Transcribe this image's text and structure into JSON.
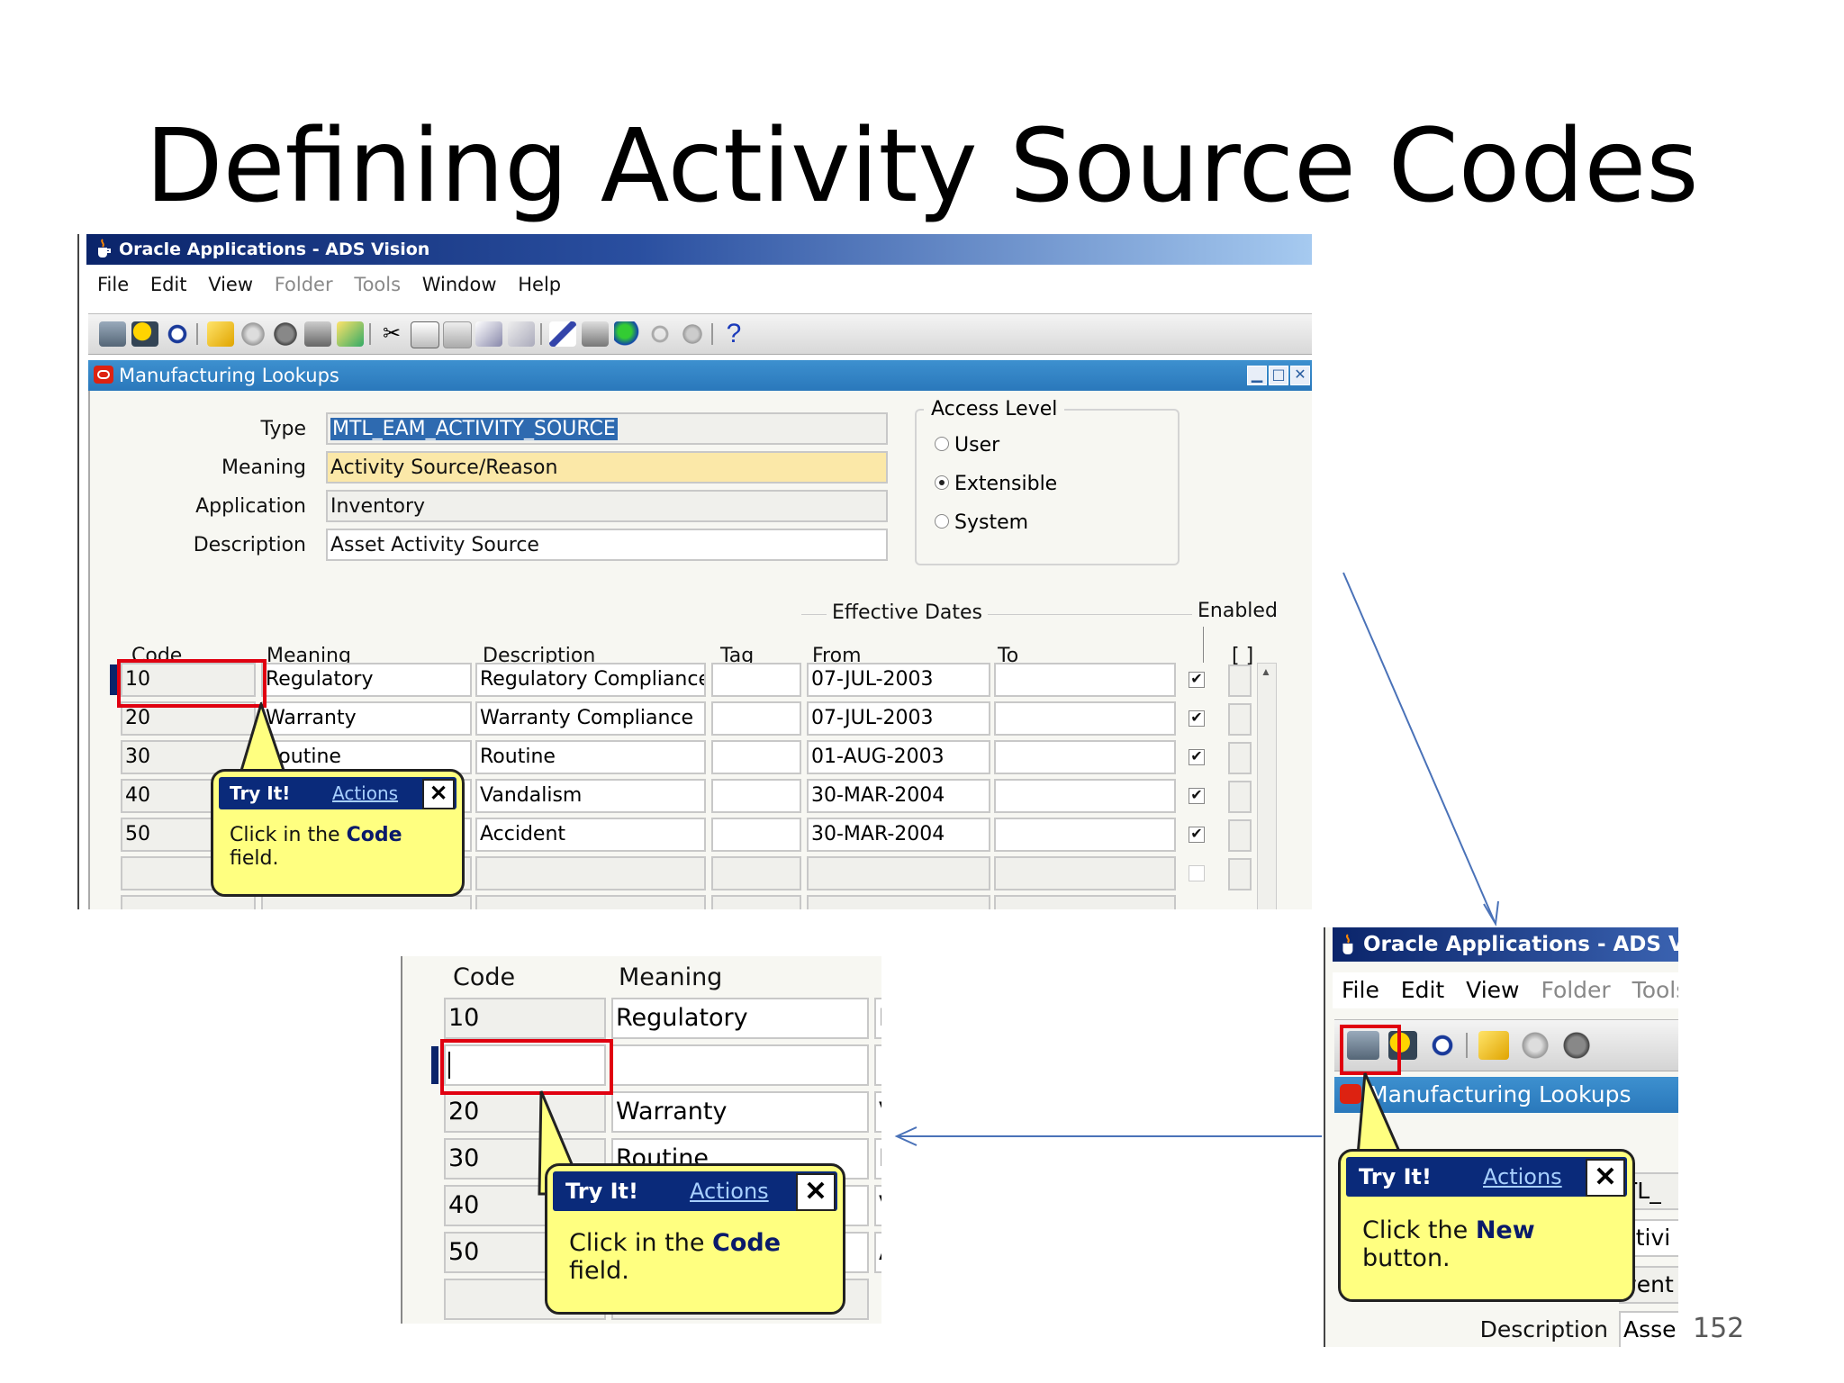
{
  "slide": {
    "title": "Defining Activity Source Codes",
    "page_number": "152"
  },
  "window": {
    "title": "Oracle Applications - ADS Vision",
    "menu": [
      {
        "label": "File",
        "enabled": true
      },
      {
        "label": "Edit",
        "enabled": true
      },
      {
        "label": "View",
        "enabled": true
      },
      {
        "label": "Folder",
        "enabled": false
      },
      {
        "label": "Tools",
        "enabled": false
      },
      {
        "label": "Window",
        "enabled": true
      },
      {
        "label": "Help",
        "enabled": true
      }
    ],
    "toolbar_icons": [
      "new-record-icon",
      "find-icon",
      "navigator-icon",
      "save-icon",
      "next-step-icon",
      "switch-responsibility-icon",
      "print-icon",
      "close-form-icon",
      "cut-icon",
      "copy-icon",
      "paste-icon",
      "clear-record-icon",
      "delete-record-icon",
      "edit-field-icon",
      "zoom-icon",
      "translations-icon",
      "attachments-icon",
      "folder-tools-icon",
      "help-icon"
    ],
    "help_glyph": "?"
  },
  "form": {
    "title": "Manufacturing Lookups",
    "type_label": "Type",
    "type_value": "MTL_EAM_ACTIVITY_SOURCE",
    "meaning_label": "Meaning",
    "meaning_value": "Activity Source/Reason",
    "application_label": "Application",
    "application_value": "Inventory",
    "description_label": "Description",
    "description_value": "Asset Activity Source",
    "access_level": {
      "title": "Access Level",
      "options": [
        "User",
        "Extensible",
        "System"
      ],
      "selected": "Extensible"
    },
    "effective_dates_label": "Effective Dates",
    "enabled_label": "Enabled",
    "dff_label": "[ ]",
    "columns": {
      "code": "Code",
      "meaning": "Meaning",
      "description": "Description",
      "tag": "Tag",
      "from": "From",
      "to": "To"
    },
    "rows": [
      {
        "code": "10",
        "meaning": "Regulatory",
        "description": "Regulatory Compliance",
        "tag": "",
        "from": "07-JUL-2003",
        "to": "",
        "enabled": true
      },
      {
        "code": "20",
        "meaning": "Warranty",
        "description": "Warranty Compliance",
        "tag": "",
        "from": "07-JUL-2003",
        "to": "",
        "enabled": true
      },
      {
        "code": "30",
        "meaning": "Routine",
        "description": "Routine",
        "tag": "",
        "from": "01-AUG-2003",
        "to": "",
        "enabled": true
      },
      {
        "code": "40",
        "meaning": "",
        "description": "Vandalism",
        "tag": "",
        "from": "30-MAR-2004",
        "to": "",
        "enabled": true
      },
      {
        "code": "50",
        "meaning": "",
        "description": "Accident",
        "tag": "",
        "from": "30-MAR-2004",
        "to": "",
        "enabled": true
      }
    ],
    "check_mark": "✔"
  },
  "callouts": {
    "main": {
      "title": "Try It!",
      "actions": "Actions",
      "close": "✕",
      "text_before": "Click in the ",
      "text_bold": "Code",
      "text_after": "field."
    },
    "zoom": {
      "title": "Try It!",
      "actions": "Actions",
      "close": "✕",
      "text_before": "Click in the ",
      "text_bold": "Code",
      "text_after": "field."
    },
    "right": {
      "title": "Try It!",
      "actions": "Actions",
      "close": "✕",
      "text_before": "Click the ",
      "text_bold": "New",
      "text_after": "button."
    }
  },
  "zoom_crop": {
    "code_header": "Code",
    "meaning_header": "Meaning",
    "rows": [
      {
        "code": "10",
        "meaning": "Regulatory",
        "edge": "F"
      },
      {
        "code": "",
        "meaning": "",
        "edge": ""
      },
      {
        "code": "20",
        "meaning": "Warranty",
        "edge": "V"
      },
      {
        "code": "30",
        "meaning": "Routine",
        "edge": "F"
      },
      {
        "code": "40",
        "meaning": "",
        "edge": "V"
      },
      {
        "code": "50",
        "meaning": "",
        "edge": "A"
      }
    ]
  },
  "right_crop": {
    "title": "Oracle Applications - ADS Vis",
    "menu": [
      "File",
      "Edit",
      "View",
      "Folder",
      "Tools"
    ],
    "form_title": "Manufacturing Lookups",
    "partial_fields": [
      "TL_",
      "ctivi",
      "vent",
      "Asse"
    ],
    "description_label": "Description"
  },
  "colors": {
    "title_bar_start": "#0a246a",
    "form_title": "#2a78bb",
    "required_field": "#fbe8a8",
    "highlight_box": "#e00010",
    "callout_bg": "#ffff80",
    "arrow": "#4a72b8"
  }
}
